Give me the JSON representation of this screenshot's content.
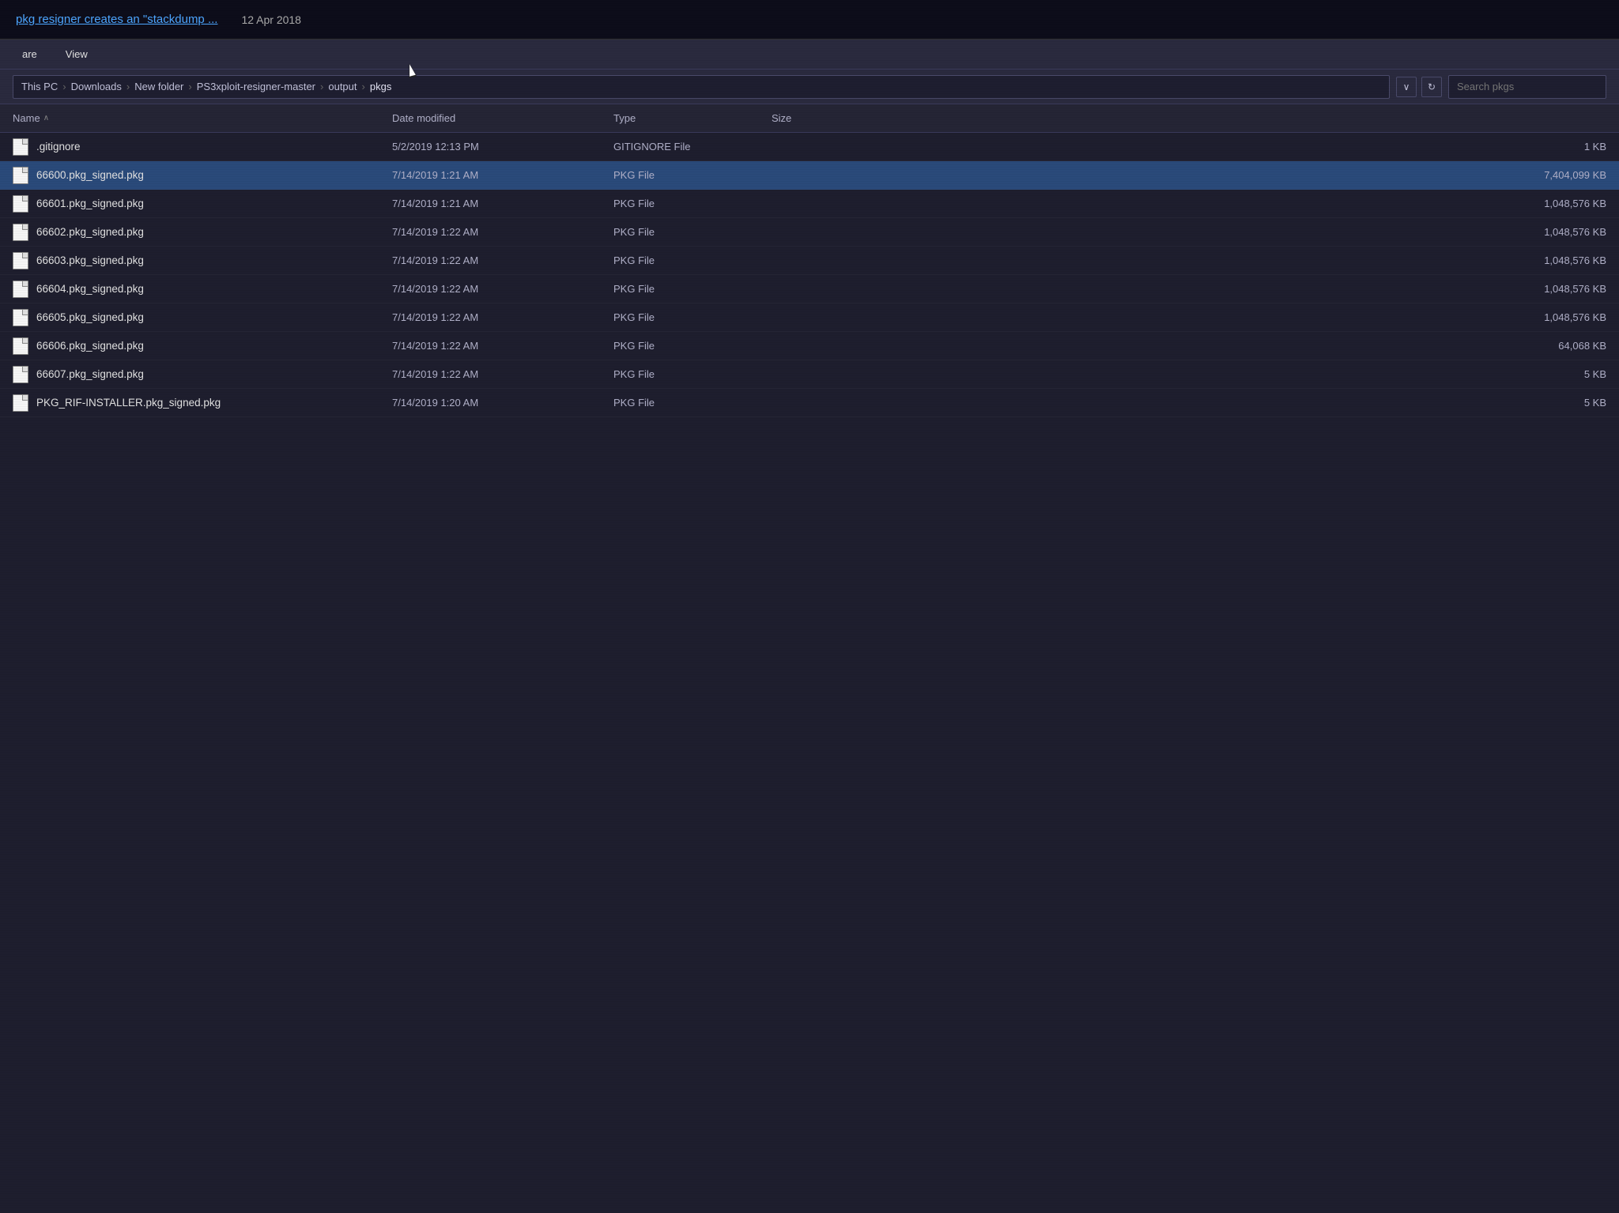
{
  "topbar": {
    "link_text": "pkg resigner creates an \"stackdump ...",
    "date": "12 Apr 2018"
  },
  "menubar": {
    "items": [
      "are",
      "View"
    ]
  },
  "addressbar": {
    "breadcrumbs": [
      {
        "label": "This PC"
      },
      {
        "label": "Downloads"
      },
      {
        "label": "New folder"
      },
      {
        "label": "PS3xploit-resigner-master"
      },
      {
        "label": "output"
      },
      {
        "label": "pkgs"
      }
    ],
    "search_placeholder": "Search pkgs"
  },
  "columns": {
    "name": "Name",
    "date": "Date modified",
    "type": "Type",
    "size": "Size"
  },
  "files": [
    {
      "name": ".gitignore",
      "date": "5/2/2019 12:13 PM",
      "type": "GITIGNORE File",
      "size": "1 KB",
      "selected": false
    },
    {
      "name": "66600.pkg_signed.pkg",
      "date": "7/14/2019 1:21 AM",
      "type": "PKG File",
      "size": "7,404,099 KB",
      "selected": true
    },
    {
      "name": "66601.pkg_signed.pkg",
      "date": "7/14/2019 1:21 AM",
      "type": "PKG File",
      "size": "1,048,576 KB",
      "selected": false
    },
    {
      "name": "66602.pkg_signed.pkg",
      "date": "7/14/2019 1:22 AM",
      "type": "PKG File",
      "size": "1,048,576 KB",
      "selected": false
    },
    {
      "name": "66603.pkg_signed.pkg",
      "date": "7/14/2019 1:22 AM",
      "type": "PKG File",
      "size": "1,048,576 KB",
      "selected": false
    },
    {
      "name": "66604.pkg_signed.pkg",
      "date": "7/14/2019 1:22 AM",
      "type": "PKG File",
      "size": "1,048,576 KB",
      "selected": false
    },
    {
      "name": "66605.pkg_signed.pkg",
      "date": "7/14/2019 1:22 AM",
      "type": "PKG File",
      "size": "1,048,576 KB",
      "selected": false
    },
    {
      "name": "66606.pkg_signed.pkg",
      "date": "7/14/2019 1:22 AM",
      "type": "PKG File",
      "size": "64,068 KB",
      "selected": false
    },
    {
      "name": "66607.pkg_signed.pkg",
      "date": "7/14/2019 1:22 AM",
      "type": "PKG File",
      "size": "5 KB",
      "selected": false
    },
    {
      "name": "PKG_RIF-INSTALLER.pkg_signed.pkg",
      "date": "7/14/2019 1:20 AM",
      "type": "PKG File",
      "size": "5 KB",
      "selected": false
    }
  ]
}
